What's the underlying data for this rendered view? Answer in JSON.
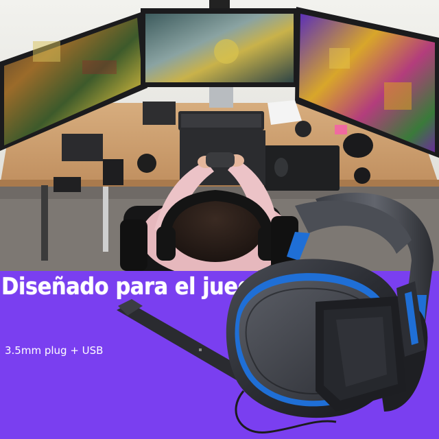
{
  "banner": {
    "headline": "Diseñado para el juego",
    "subline": "3.5mm plug + USB"
  },
  "colors": {
    "background_purple": "#7a3ff0",
    "headline_text": "#ffffff",
    "headset_accent_blue": "#1f6fd6",
    "headset_body": "#2b2d33",
    "desk_wood": "#c69a6b"
  },
  "images": {
    "photo": "gaming-setup-photo",
    "product": "gaming-headset-with-microphone"
  }
}
